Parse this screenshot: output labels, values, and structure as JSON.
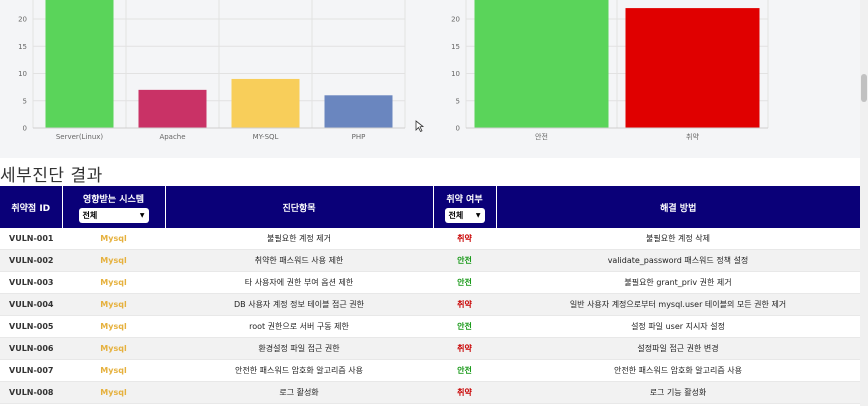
{
  "chart_data": [
    {
      "type": "bar",
      "categories": [
        "Server(Linux)",
        "Apache",
        "MY-SQL",
        "PHP"
      ],
      "values": [
        25,
        7,
        9,
        6
      ],
      "colors": [
        "#5ad45a",
        "#c93266",
        "#f8ce5a",
        "#6a86bf"
      ],
      "y_ticks": [
        0,
        5,
        10,
        15,
        20
      ],
      "ylim": [
        0,
        26
      ],
      "grid": true
    },
    {
      "type": "bar",
      "categories": [
        "안전",
        "취약"
      ],
      "values": [
        27,
        22
      ],
      "colors": [
        "#5ad45a",
        "#e00000"
      ],
      "y_ticks": [
        0,
        5,
        10,
        15,
        20
      ],
      "ylim": [
        0,
        26
      ],
      "grid": true
    }
  ],
  "section_title": "세부진단 결과",
  "table": {
    "headers": {
      "id": "취약점 ID",
      "system": "영향받는 시스템",
      "system_filter": "전체",
      "item": "진단항목",
      "vuln": "취약 여부",
      "vuln_filter": "전체",
      "solution": "해결 방법"
    },
    "rows": [
      {
        "id": "VULN-001",
        "system": "Mysql",
        "item": "불필요한 계정 제거",
        "status": "취약",
        "solution": "불필요한 계정 삭제"
      },
      {
        "id": "VULN-002",
        "system": "Mysql",
        "item": "취약한 패스워드 사용 제한",
        "status": "안전",
        "solution": "validate_password 패스워드 정책 설정"
      },
      {
        "id": "VULN-003",
        "system": "Mysql",
        "item": "타 사용자에 권한 부여 옵션 제한",
        "status": "안전",
        "solution": "불필요한 grant_priv 권한 제거"
      },
      {
        "id": "VULN-004",
        "system": "Mysql",
        "item": "DB 사용자 계정 정보 테이블 접근 권한",
        "status": "취약",
        "solution": "일반 사용자 계정으로부터 mysql.user 테이블의 모든 권한 제거"
      },
      {
        "id": "VULN-005",
        "system": "Mysql",
        "item": "root 권한으로 서버 구동 제한",
        "status": "안전",
        "solution": "설정 파일 user 지시자 설정"
      },
      {
        "id": "VULN-006",
        "system": "Mysql",
        "item": "환경설정 파일 접근 권한",
        "status": "취약",
        "solution": "설정파일 접근 권한 변경"
      },
      {
        "id": "VULN-007",
        "system": "Mysql",
        "item": "안전한 패스워드 암호화 알고리즘 사용",
        "status": "안전",
        "solution": "안전한 패스워드 암호화 알고리즘 사용"
      },
      {
        "id": "VULN-008",
        "system": "Mysql",
        "item": "로그 활성화",
        "status": "취약",
        "solution": "로그 기능 활성화"
      }
    ]
  },
  "colors": {
    "header_bg": "#0a0078",
    "vuln": "#c80000",
    "safe": "#1a9a1a",
    "system": "#e6b13e"
  }
}
